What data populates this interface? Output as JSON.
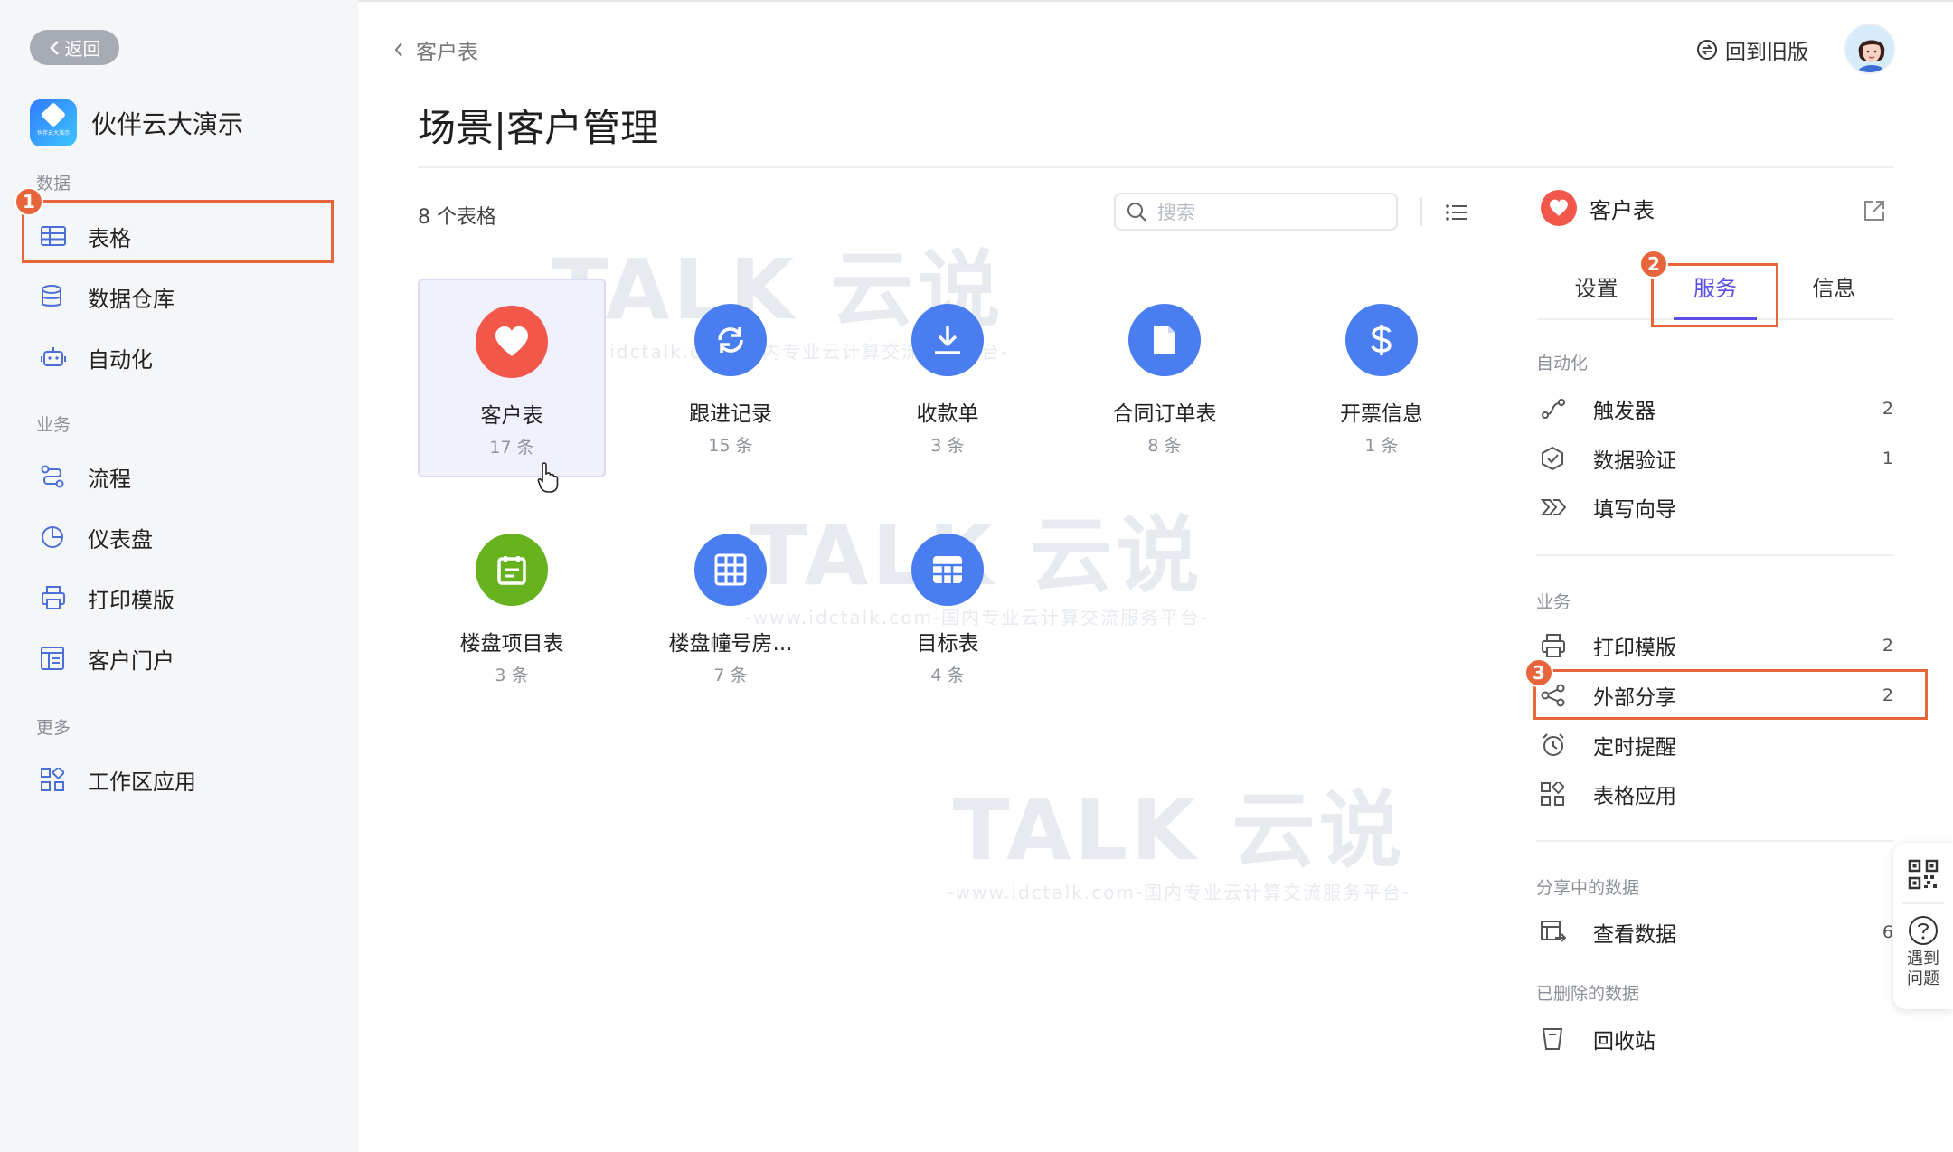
{
  "sidebar": {
    "back_label": "返回",
    "app_name": "伙伴云大演示",
    "app_logo_text": "伙伴云大演示",
    "groups": {
      "data": "数据",
      "business": "业务",
      "more": "更多"
    },
    "items": {
      "tables": "表格",
      "warehouse": "数据仓库",
      "automation": "自动化",
      "process": "流程",
      "dashboard": "仪表盘",
      "print_template": "打印模版",
      "customer_portal": "客户门户",
      "workspace_apps": "工作区应用"
    }
  },
  "header": {
    "breadcrumb": "客户表",
    "old_version": "回到旧版",
    "page_title": "场景|客户管理"
  },
  "tables": {
    "count_label": "8 个表格",
    "search_placeholder": "搜索",
    "cards": [
      {
        "name": "客户表",
        "count": "17 条",
        "icon": "heart-icon",
        "color": "#f2584a"
      },
      {
        "name": "跟进记录",
        "count": "15 条",
        "icon": "sync-icon",
        "color": "#4a7df0"
      },
      {
        "name": "收款单",
        "count": "3 条",
        "icon": "download-icon",
        "color": "#4a7df0"
      },
      {
        "name": "合同订单表",
        "count": "8 条",
        "icon": "document-icon",
        "color": "#4a7df0"
      },
      {
        "name": "开票信息",
        "count": "1 条",
        "icon": "dollar-icon",
        "color": "#4a7df0"
      },
      {
        "name": "楼盘项目表",
        "count": "3 条",
        "icon": "calendar-icon",
        "color": "#67b21f"
      },
      {
        "name": "楼盘幢号房...",
        "count": "7 条",
        "icon": "grid-icon",
        "color": "#4a7df0"
      },
      {
        "name": "目标表",
        "count": "4 条",
        "icon": "table-icon",
        "color": "#4a7df0"
      }
    ]
  },
  "right_panel": {
    "title": "客户表",
    "tabs": [
      "设置",
      "服务",
      "信息"
    ],
    "sections": {
      "automation": "自动化",
      "business": "业务",
      "sharing_data": "分享中的数据",
      "deleted_data": "已删除的数据"
    },
    "items": {
      "trigger": {
        "label": "触发器",
        "count": "2"
      },
      "validation": {
        "label": "数据验证",
        "count": "1"
      },
      "wizard": {
        "label": "填写向导",
        "count": ""
      },
      "print": {
        "label": "打印模版",
        "count": "2"
      },
      "share": {
        "label": "外部分享",
        "count": "2"
      },
      "reminder": {
        "label": "定时提醒",
        "count": ""
      },
      "table_apps": {
        "label": "表格应用",
        "count": ""
      },
      "view_data": {
        "label": "查看数据",
        "count": "6"
      },
      "recycle": {
        "label": "回收站",
        "count": ""
      }
    }
  },
  "float_rail": {
    "help_label": "遇到问题"
  },
  "annotations": {
    "step1": "1",
    "step2": "2",
    "step3": "3"
  },
  "watermark": {
    "brand": "TALK 云说",
    "tagline": "-www.idctalk.com-国内专业云计算交流服务平台-"
  }
}
